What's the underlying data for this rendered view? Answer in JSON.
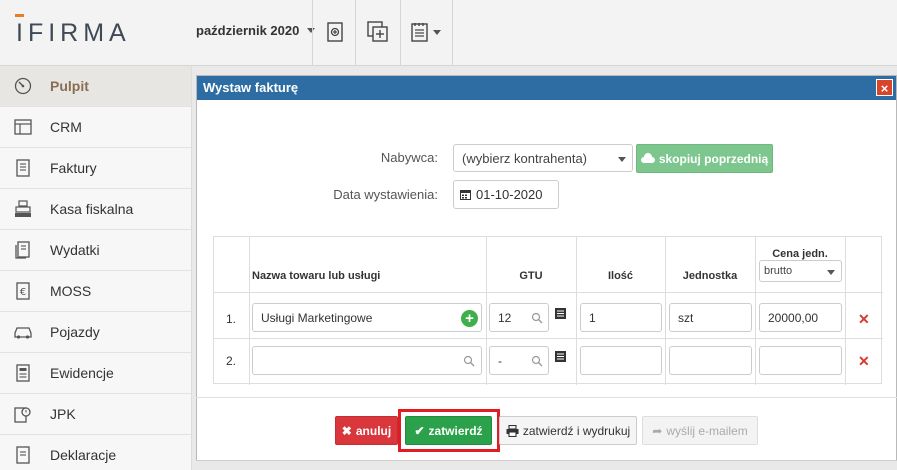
{
  "app": {
    "logo_text": "IFIRMA",
    "period_label": "październik 2020"
  },
  "toolbar": {
    "icons": [
      "add-document-icon",
      "copy-plus-icon",
      "notes-menu-icon"
    ]
  },
  "sidebar": {
    "items": [
      {
        "label": "Pulpit",
        "icon": "dashboard-icon",
        "active": true
      },
      {
        "label": "CRM",
        "icon": "crm-icon",
        "active": false
      },
      {
        "label": "Faktury",
        "icon": "invoice-icon",
        "active": false
      },
      {
        "label": "Kasa fiskalna",
        "icon": "cash-register-icon",
        "active": false
      },
      {
        "label": "Wydatki",
        "icon": "expenses-icon",
        "active": false
      },
      {
        "label": "MOSS",
        "icon": "moss-icon",
        "active": false
      },
      {
        "label": "Pojazdy",
        "icon": "car-icon",
        "active": false
      },
      {
        "label": "Ewidencje",
        "icon": "records-icon",
        "active": false
      },
      {
        "label": "JPK",
        "icon": "jpk-icon",
        "active": false
      },
      {
        "label": "Deklaracje",
        "icon": "declarations-icon",
        "active": false
      }
    ]
  },
  "modal": {
    "title": "Wystaw fakturę",
    "close_glyph": "×",
    "buyer_label": "Nabywca:",
    "buyer_value": "(wybierz kontrahenta)",
    "copy_button": "skopiuj poprzednią",
    "date_label": "Data wystawienia:",
    "date_value": "01-10-2020",
    "table": {
      "headers": {
        "name": "Nazwa towaru lub usługi",
        "gtu": "GTU",
        "qty": "Ilość",
        "unit": "Jednostka",
        "price": "Cena jedn.",
        "price_type": "brutto"
      },
      "rows": [
        {
          "num": "1.",
          "name": "Usługi Marketingowe",
          "gtu": "12",
          "qty": "1",
          "unit": "szt",
          "price": "20000,00"
        },
        {
          "num": "2.",
          "name": "",
          "gtu": "-",
          "qty": "",
          "unit": "",
          "price": ""
        }
      ]
    },
    "buttons": {
      "cancel": "anuluj",
      "confirm": "zatwierdź",
      "confirm_print": "zatwierdź i wydrukuj",
      "send_email": "wyślij e-mailem"
    }
  },
  "colors": {
    "header_blue": "#2d6da3",
    "confirm_green": "#2aa14a",
    "cancel_red": "#d9373b",
    "highlight_red": "#e31b23",
    "accent_orange": "#e57e26"
  }
}
